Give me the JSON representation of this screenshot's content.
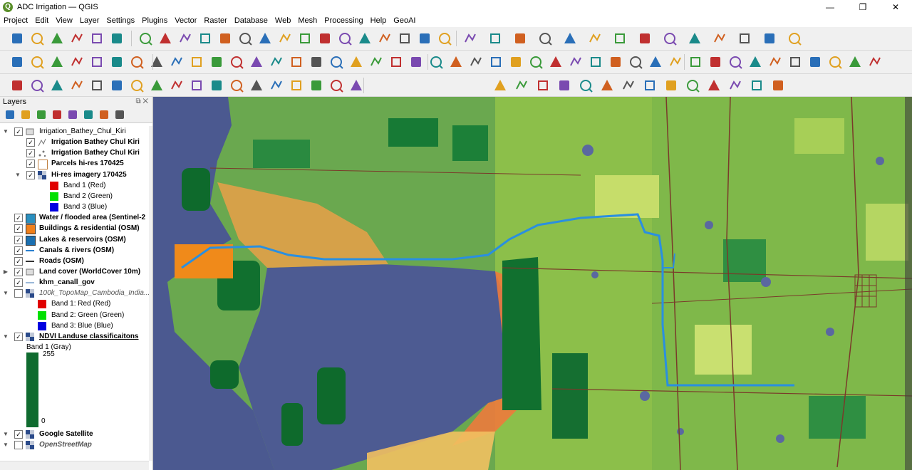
{
  "window": {
    "title": "ADC Irrigation — QGIS",
    "app_icon_letter": "Q",
    "controls": [
      "—",
      "❐",
      "✕"
    ]
  },
  "menu": [
    "Project",
    "Edit",
    "View",
    "Layer",
    "Settings",
    "Plugins",
    "Vector",
    "Raster",
    "Database",
    "Web",
    "Mesh",
    "Processing",
    "Help",
    "GeoAI"
  ],
  "layers_panel": {
    "title": "Layers",
    "header_buttons": "⧉ ✕",
    "layers": [
      {
        "name": "Irrigation_Bathey_Chul_Kiri",
        "level": 0,
        "expanded": true,
        "checked": true,
        "bold": false,
        "italic": false,
        "symbol": "group-icon"
      },
      {
        "name": "Irrigation Bathey Chul Kiri",
        "level": 1,
        "checked": true,
        "bold": true,
        "symbol": "line-icon"
      },
      {
        "name": "Irrigation Bathey Chul Kiri",
        "level": 1,
        "checked": true,
        "bold": true,
        "symbol": "point-icon"
      },
      {
        "name": "Parcels hi-res 170425",
        "level": 1,
        "checked": true,
        "bold": true,
        "symbol": "polygon-empty-icon"
      },
      {
        "name": "Hi-res imagery 170425",
        "level": 1,
        "expanded": true,
        "checked": true,
        "bold": true,
        "symbol": "raster-icon"
      },
      {
        "name": "Band 1 (Red)",
        "level": 2,
        "legend": true,
        "color": "#e00000"
      },
      {
        "name": "Band 2 (Green)",
        "level": 2,
        "legend": true,
        "color": "#00e000"
      },
      {
        "name": "Band 3 (Blue)",
        "level": 2,
        "legend": true,
        "color": "#0000e0"
      },
      {
        "name": "Water / flooded area (Sentinel-2",
        "level": 0,
        "checked": true,
        "bold": true,
        "symbol": "fill-icon",
        "color": "#2a8fbf"
      },
      {
        "name": "Buildings & residential (OSM)",
        "level": 0,
        "checked": true,
        "bold": true,
        "symbol": "fill-icon",
        "color": "#f07f1a"
      },
      {
        "name": "Lakes & reservoirs (OSM)",
        "level": 0,
        "checked": true,
        "bold": true,
        "symbol": "fill-icon",
        "color": "#1a6fb0"
      },
      {
        "name": "Canals & rivers (OSM)",
        "level": 0,
        "checked": true,
        "bold": true,
        "symbol": "stroke-icon",
        "color": "#2a7fd0"
      },
      {
        "name": "Roads (OSM)",
        "level": 0,
        "checked": true,
        "bold": true,
        "symbol": "stroke-icon",
        "color": "#333333"
      },
      {
        "name": "Land cover (WorldCover 10m)",
        "level": 0,
        "expanded": false,
        "checked": true,
        "bold": true,
        "symbol": "group-icon"
      },
      {
        "name": "khm_canall_gov",
        "level": 0,
        "checked": true,
        "bold": true,
        "symbol": "stroke-icon",
        "color": "#9ab8d8"
      },
      {
        "name": "100k_TopoMap_Cambodia_India...",
        "level": 0,
        "expanded": true,
        "checked": false,
        "italic": true,
        "symbol": "raster-icon"
      },
      {
        "name": "Band 1: Red (Red)",
        "level": 1,
        "legend": true,
        "color": "#e00000"
      },
      {
        "name": "Band 2: Green (Green)",
        "level": 1,
        "legend": true,
        "color": "#00e000"
      },
      {
        "name": "Band 3: Blue (Blue)",
        "level": 1,
        "legend": true,
        "color": "#0000e0"
      },
      {
        "name": "NDVI Landuse classificaitons",
        "level": 0,
        "expanded": true,
        "checked": true,
        "bold": true,
        "underline": true,
        "symbol": "raster-icon"
      }
    ],
    "ndvi_legend": {
      "band_label": "Band 1 (Gray)",
      "max_label": "255",
      "min_label": "0",
      "color": "#0f6b2f"
    },
    "bottom_layers": [
      {
        "name": "Google Satellite",
        "checked": true,
        "bold": true,
        "italic": false
      },
      {
        "name": "OpenStreetMap",
        "checked": false,
        "bold": true,
        "italic": true
      }
    ]
  },
  "map": {
    "canal_color": "#2a8fe0",
    "water_color": "#4b5990",
    "building_color": "#f08a1a"
  }
}
